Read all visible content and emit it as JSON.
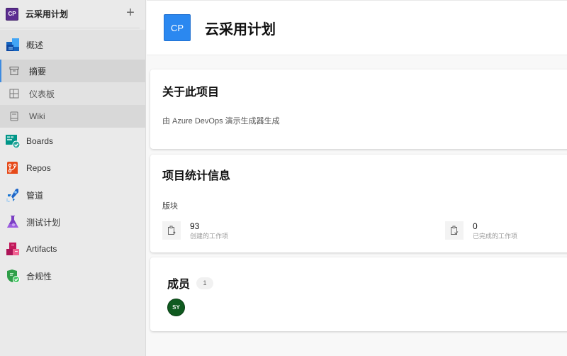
{
  "sidebar": {
    "project": {
      "initials": "CP",
      "name": "云采用计划",
      "add_icon": "plus-icon"
    },
    "overview": {
      "label": "概述",
      "icon": "overview-icon"
    },
    "sub_items": [
      {
        "label": "摘要",
        "icon": "summary-icon",
        "selected": true
      },
      {
        "label": "仪表板",
        "icon": "dashboard-icon"
      },
      {
        "label": "Wiki",
        "icon": "wiki-icon"
      }
    ],
    "items": [
      {
        "label": "Boards",
        "icon": "boards-icon"
      },
      {
        "label": "Repos",
        "icon": "repos-icon"
      },
      {
        "label": "管道",
        "icon": "pipelines-icon"
      },
      {
        "label": "测试计划",
        "icon": "test-plans-icon"
      },
      {
        "label": "Artifacts",
        "icon": "artifacts-icon"
      },
      {
        "label": "合规性",
        "icon": "compliance-icon"
      }
    ]
  },
  "header": {
    "initials": "CP",
    "title": "云采用计划",
    "avatar_color": "#2b88f0"
  },
  "about": {
    "title": "关于此项目",
    "description": "由 Azure DevOps 演示生成器生成"
  },
  "stats": {
    "title": "项目统计信息",
    "section": "版块",
    "items": [
      {
        "value": "93",
        "label": "创建的工作项"
      },
      {
        "value": "0",
        "label": "已完成的工作项"
      }
    ]
  },
  "members": {
    "title": "成员",
    "count": "1",
    "avatars": [
      {
        "initials": "SY",
        "color": "#0f5a1f"
      }
    ]
  }
}
